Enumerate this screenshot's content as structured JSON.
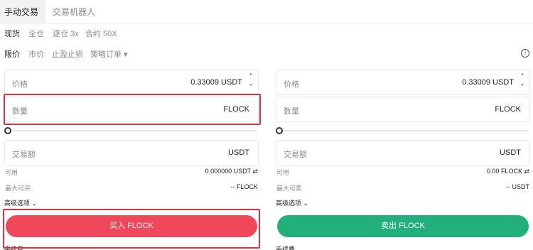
{
  "tabs": [
    {
      "label": "手动交易",
      "active": true
    },
    {
      "label": "交易机器人",
      "active": false
    }
  ],
  "modes": [
    {
      "label": "现货",
      "active": true
    },
    {
      "label": "全仓",
      "active": false
    },
    {
      "label": "逐仓 3x",
      "active": false
    },
    {
      "label": "合约 50X",
      "active": false
    }
  ],
  "order_types": [
    {
      "label": "限价",
      "active": true
    },
    {
      "label": "市价",
      "active": false
    },
    {
      "label": "止盈止损",
      "active": false
    },
    {
      "label": "策略订单 ▾",
      "active": false
    }
  ],
  "buy": {
    "price_label": "价格",
    "price_value": "0.33009 USDT",
    "qty_label": "数量",
    "qty_value": "FLOCK",
    "slider_level": 0,
    "amount_label": "交易额",
    "amount_value": "USDT",
    "avail_label": "可用",
    "avail_value": "0.000000 USDT ⇄",
    "max_label": "最大可买",
    "max_value": "-- FLOCK",
    "advanced_label": "高级选项 ⌄",
    "action_label": "买入 FLOCK",
    "fee_label": "手续费"
  },
  "sell": {
    "price_label": "价格",
    "price_value": "0.33009 USDT",
    "qty_label": "数量",
    "qty_value": "FLOCK",
    "slider_level": 0,
    "amount_label": "交易额",
    "amount_value": "USDT",
    "avail_label": "可用",
    "avail_value": "0.00 FLOCK ⇄",
    "max_label": "最大可卖",
    "max_value": "-- USDT",
    "advanced_label": "高级选项 ⌄",
    "action_label": "卖出 FLOCK",
    "fee_label": "手续费"
  },
  "colors": {
    "buy": "#f0475a",
    "sell": "#21b07a",
    "highlight": "#d9333f"
  }
}
